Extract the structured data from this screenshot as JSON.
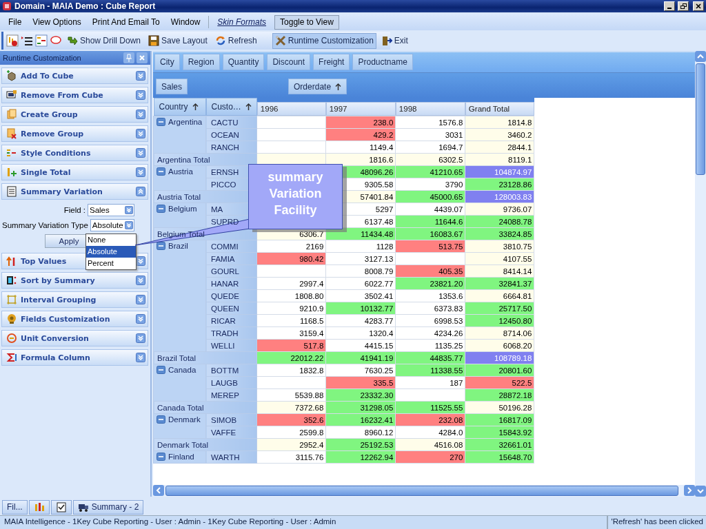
{
  "window": {
    "title": "Domain - MAIA Demo : Cube Report"
  },
  "menu": [
    {
      "kind": "menu",
      "label": "File"
    },
    {
      "kind": "menu",
      "label": "View Options"
    },
    {
      "kind": "menu",
      "label": "Print And Email To"
    },
    {
      "kind": "menu",
      "label": "Window"
    },
    {
      "kind": "link",
      "label": "Skin Formats"
    },
    {
      "kind": "button",
      "label": "Toggle to View"
    }
  ],
  "toolbar": {
    "groups": [
      [
        {
          "label": "Show Drill Down",
          "selected": false
        },
        {
          "label": "Save Layout",
          "selected": false
        },
        {
          "label": "Refresh",
          "selected": false
        }
      ],
      [
        {
          "label": "Runtime Customization",
          "selected": true
        },
        {
          "label": "Exit",
          "selected": false
        }
      ]
    ]
  },
  "panel": {
    "title": "Runtime Customization",
    "sections": [
      {
        "label": "Add To Cube",
        "expanded": false
      },
      {
        "label": "Remove From Cube",
        "expanded": false
      },
      {
        "label": "Create Group",
        "expanded": false
      },
      {
        "label": "Remove Group",
        "expanded": false
      },
      {
        "label": "Style Conditions",
        "expanded": false
      },
      {
        "label": "Single Total",
        "expanded": false
      },
      {
        "label": "Summary Variation",
        "expanded": true,
        "form": {
          "field_label": "Field :",
          "field_value": "Sales",
          "type_label": "Summary Variation Type",
          "type_value": "Absolute",
          "apply": "Apply",
          "options": [
            {
              "label": "None",
              "selected": false
            },
            {
              "label": "Absolute",
              "selected": true
            },
            {
              "label": "Percent",
              "selected": false
            }
          ]
        }
      },
      {
        "label": "Top Values",
        "expanded": false
      },
      {
        "label": "Sort by Summary",
        "expanded": false
      },
      {
        "label": "Interval Grouping",
        "expanded": false
      },
      {
        "label": "Fields Customization",
        "expanded": false
      },
      {
        "label": "Unit Conversion",
        "expanded": false
      },
      {
        "label": "Formula Column",
        "expanded": false
      }
    ]
  },
  "pivot": {
    "filter_fields": [
      "City",
      "Region",
      "Quantity",
      "Discount",
      "Freight",
      "Productname"
    ],
    "data_fields": [
      "Sales"
    ],
    "column_fields": [
      {
        "label": "Orderdate"
      }
    ],
    "row_fields": [
      {
        "label": "Country"
      },
      {
        "label": "Custo…"
      }
    ],
    "columns": [
      "1996",
      "1997",
      "1998",
      "Grand Total"
    ],
    "groups": [
      {
        "country": "Argentina",
        "expanded": true,
        "rows": [
          {
            "customer": "CACTU",
            "cells": [
              {
                "color": "#ffffff"
              },
              {
                "v": "238.0",
                "color": "#ff8080"
              },
              {
                "v": "1576.8",
                "color": "#ffffff"
              },
              {
                "v": "1814.8",
                "color": "#fffdea"
              }
            ]
          },
          {
            "customer": "OCEAN",
            "cells": [
              {
                "color": "#ffffff"
              },
              {
                "v": "429.2",
                "color": "#ff8080"
              },
              {
                "v": "3031",
                "color": "#ffffff"
              },
              {
                "v": "3460.2",
                "color": "#fffdea"
              }
            ]
          },
          {
            "customer": "RANCH",
            "cells": [
              {
                "color": "#ffffff"
              },
              {
                "v": "1149.4",
                "color": "#ffffff"
              },
              {
                "v": "1694.7",
                "color": "#ffffff"
              },
              {
                "v": "2844.1",
                "color": "#fffdea"
              }
            ]
          }
        ],
        "total": {
          "label": "Argentina Total",
          "cells": [
            {
              "color": "#fffdea"
            },
            {
              "v": "1816.6",
              "color": "#fffdea"
            },
            {
              "v": "6302.5",
              "color": "#fffdea"
            },
            {
              "v": "8119.1",
              "color": "#fffdea"
            }
          ]
        }
      },
      {
        "country": "Austria",
        "expanded": true,
        "rows": [
          {
            "customer": "ERNSH",
            "cells": [
              null,
              {
                "v": "48096.26",
                "color": "#80f580"
              },
              {
                "v": "41210.65",
                "color": "#80f580"
              },
              {
                "v": "104874.97",
                "color": "#8080f0"
              }
            ]
          },
          {
            "customer": "PICCO",
            "cells": [
              null,
              {
                "v": "9305.58",
                "color": "#ffffff"
              },
              {
                "v": "3790",
                "color": "#ffffff"
              },
              {
                "v": "23128.86",
                "color": "#80f580"
              }
            ]
          }
        ],
        "total": {
          "label": "Austria Total",
          "cells": [
            null,
            {
              "v": "57401.84",
              "color": "#fffdea"
            },
            {
              "v": "45000.65",
              "color": "#80f580"
            },
            {
              "v": "128003.83",
              "color": "#8080f0"
            }
          ]
        }
      },
      {
        "country": "Belgium",
        "expanded": true,
        "rows": [
          {
            "customer": "MA",
            "cells": [
              null,
              {
                "v": "5297",
                "color": "#ffffff"
              },
              {
                "v": "4439.07",
                "color": "#ffffff"
              },
              {
                "v": "9736.07",
                "color": "#fffdea"
              }
            ]
          },
          {
            "customer": "SUPRD",
            "cells": [
              null,
              {
                "v": "6137.48",
                "color": "#ffffff"
              },
              {
                "v": "11644.6",
                "color": "#80f580"
              },
              {
                "v": "24088.78",
                "color": "#80f580"
              }
            ]
          }
        ],
        "total": {
          "label": "Belgium Total",
          "cells": [
            {
              "v": "6306.7",
              "color": "#fffdea"
            },
            {
              "v": "11434.48",
              "color": "#80f580"
            },
            {
              "v": "16083.67",
              "color": "#80f580"
            },
            {
              "v": "33824.85",
              "color": "#80f580"
            }
          ]
        }
      },
      {
        "country": "Brazil",
        "expanded": true,
        "rows": [
          {
            "customer": "COMMI",
            "cells": [
              {
                "v": "2169",
                "color": "#ffffff"
              },
              {
                "v": "1128",
                "color": "#ffffff"
              },
              {
                "v": "513.75",
                "color": "#ff8080"
              },
              {
                "v": "3810.75",
                "color": "#fffdea"
              }
            ]
          },
          {
            "customer": "FAMIA",
            "cells": [
              {
                "v": "980.42",
                "color": "#ff8080"
              },
              {
                "v": "3127.13",
                "color": "#ffffff"
              },
              {
                "color": "#ffffff"
              },
              {
                "v": "4107.55",
                "color": "#fffdea"
              }
            ]
          },
          {
            "customer": "GOURL",
            "cells": [
              {
                "color": "#ffffff"
              },
              {
                "v": "8008.79",
                "color": "#ffffff"
              },
              {
                "v": "405.35",
                "color": "#ff8080"
              },
              {
                "v": "8414.14",
                "color": "#fffdea"
              }
            ]
          },
          {
            "customer": "HANAR",
            "cells": [
              {
                "v": "2997.4",
                "color": "#ffffff"
              },
              {
                "v": "6022.77",
                "color": "#ffffff"
              },
              {
                "v": "23821.20",
                "color": "#80f580"
              },
              {
                "v": "32841.37",
                "color": "#80f580"
              }
            ]
          },
          {
            "customer": "QUEDE",
            "cells": [
              {
                "v": "1808.80",
                "color": "#ffffff"
              },
              {
                "v": "3502.41",
                "color": "#ffffff"
              },
              {
                "v": "1353.6",
                "color": "#ffffff"
              },
              {
                "v": "6664.81",
                "color": "#fffdea"
              }
            ]
          },
          {
            "customer": "QUEEN",
            "cells": [
              {
                "v": "9210.9",
                "color": "#ffffff"
              },
              {
                "v": "10132.77",
                "color": "#80f580"
              },
              {
                "v": "6373.83",
                "color": "#ffffff"
              },
              {
                "v": "25717.50",
                "color": "#80f580"
              }
            ]
          },
          {
            "customer": "RICAR",
            "cells": [
              {
                "v": "1168.5",
                "color": "#ffffff"
              },
              {
                "v": "4283.77",
                "color": "#ffffff"
              },
              {
                "v": "6998.53",
                "color": "#ffffff"
              },
              {
                "v": "12450.80",
                "color": "#80f580"
              }
            ]
          },
          {
            "customer": "TRADH",
            "cells": [
              {
                "v": "3159.4",
                "color": "#ffffff"
              },
              {
                "v": "1320.4",
                "color": "#ffffff"
              },
              {
                "v": "4234.26",
                "color": "#ffffff"
              },
              {
                "v": "8714.06",
                "color": "#fffdea"
              }
            ]
          },
          {
            "customer": "WELLI",
            "cells": [
              {
                "v": "517.8",
                "color": "#ff8080"
              },
              {
                "v": "4415.15",
                "color": "#ffffff"
              },
              {
                "v": "1135.25",
                "color": "#ffffff"
              },
              {
                "v": "6068.20",
                "color": "#fffdea"
              }
            ]
          }
        ],
        "total": {
          "label": "Brazil Total",
          "cells": [
            {
              "v": "22012.22",
              "color": "#80f580"
            },
            {
              "v": "41941.19",
              "color": "#80f580"
            },
            {
              "v": "44835.77",
              "color": "#80f580"
            },
            {
              "v": "108789.18",
              "color": "#8080f0"
            }
          ]
        }
      },
      {
        "country": "Canada",
        "expanded": true,
        "rows": [
          {
            "customer": "BOTTM",
            "cells": [
              {
                "v": "1832.8",
                "color": "#ffffff"
              },
              {
                "v": "7630.25",
                "color": "#ffffff"
              },
              {
                "v": "11338.55",
                "color": "#80f580"
              },
              {
                "v": "20801.60",
                "color": "#80f580"
              }
            ]
          },
          {
            "customer": "LAUGB",
            "cells": [
              {
                "color": "#ffffff"
              },
              {
                "v": "335.5",
                "color": "#ff8080"
              },
              {
                "v": "187",
                "color": "#ffffff"
              },
              {
                "v": "522.5",
                "color": "#ff8080"
              }
            ]
          },
          {
            "customer": "MEREP",
            "cells": [
              {
                "v": "5539.88",
                "color": "#ffffff"
              },
              {
                "v": "23332.30",
                "color": "#80f580"
              },
              {
                "color": "#ffffff"
              },
              {
                "v": "28872.18",
                "color": "#80f580"
              }
            ]
          }
        ],
        "total": {
          "label": "Canada Total",
          "cells": [
            {
              "v": "7372.68",
              "color": "#fffdea"
            },
            {
              "v": "31298.05",
              "color": "#80f580"
            },
            {
              "v": "11525.55",
              "color": "#80f580"
            },
            {
              "v": "50196.28",
              "color": "#fffdea"
            }
          ]
        }
      },
      {
        "country": "Denmark",
        "expanded": true,
        "rows": [
          {
            "customer": "SIMOB",
            "cells": [
              {
                "v": "352.6",
                "color": "#ff8080"
              },
              {
                "v": "16232.41",
                "color": "#80f580"
              },
              {
                "v": "232.08",
                "color": "#ff8080"
              },
              {
                "v": "16817.09",
                "color": "#80f580"
              }
            ]
          },
          {
            "customer": "VAFFE",
            "cells": [
              {
                "v": "2599.8",
                "color": "#ffffff"
              },
              {
                "v": "8960.12",
                "color": "#ffffff"
              },
              {
                "v": "4284.0",
                "color": "#ffffff"
              },
              {
                "v": "15843.92",
                "color": "#80f580"
              }
            ]
          }
        ],
        "total": {
          "label": "Denmark Total",
          "cells": [
            {
              "v": "2952.4",
              "color": "#fffdea"
            },
            {
              "v": "25192.53",
              "color": "#80f580"
            },
            {
              "v": "4516.08",
              "color": "#fffdea"
            },
            {
              "v": "32661.01",
              "color": "#80f580"
            }
          ]
        }
      },
      {
        "country": "Finland",
        "expanded": true,
        "rows": [
          {
            "customer": "WARTH",
            "cells": [
              {
                "v": "3115.76",
                "color": "#ffffff"
              },
              {
                "v": "12262.94",
                "color": "#80f580"
              },
              {
                "v": "270",
                "color": "#ff8080"
              },
              {
                "v": "15648.70",
                "color": "#80f580"
              }
            ]
          }
        ]
      }
    ]
  },
  "callout": {
    "text": "summary Variation Facility"
  },
  "bottom_tabs": [
    {
      "label": "Fil..."
    },
    {
      "kind": "icon"
    },
    {
      "kind": "icon"
    },
    {
      "label": "Summary - 2"
    }
  ],
  "status_bar": {
    "text": "MAIA Intelligence - 1Key Cube Reporting - User : Admin - 1Key Cube Reporting - User : Admin",
    "message": "'Refresh' has been clicked"
  }
}
